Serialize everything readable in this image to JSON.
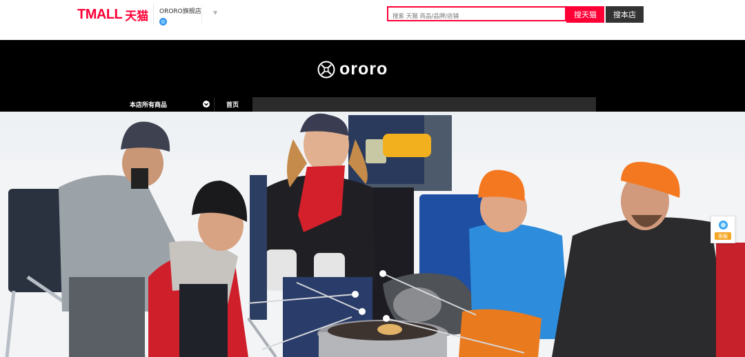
{
  "header": {
    "logo_text": "TMALL",
    "logo_cn": "天猫",
    "shop_name": "ORORO旗舰店",
    "search": {
      "placeholder": "搜索 天猫 商品/品牌/店铺",
      "search_tmall_label": "搜天猫",
      "search_shop_label": "搜本店"
    }
  },
  "store": {
    "brand": "ororo",
    "nav": {
      "all_products_label": "本店所有商品",
      "home_label": "首页"
    }
  },
  "service_widget": {
    "label": "客服"
  },
  "colors": {
    "tmall_red": "#ff0036",
    "banner_black": "#000000",
    "nav_gray": "#2b2b2b",
    "dark_button": "#333333",
    "service_orange": "#f5a623"
  }
}
